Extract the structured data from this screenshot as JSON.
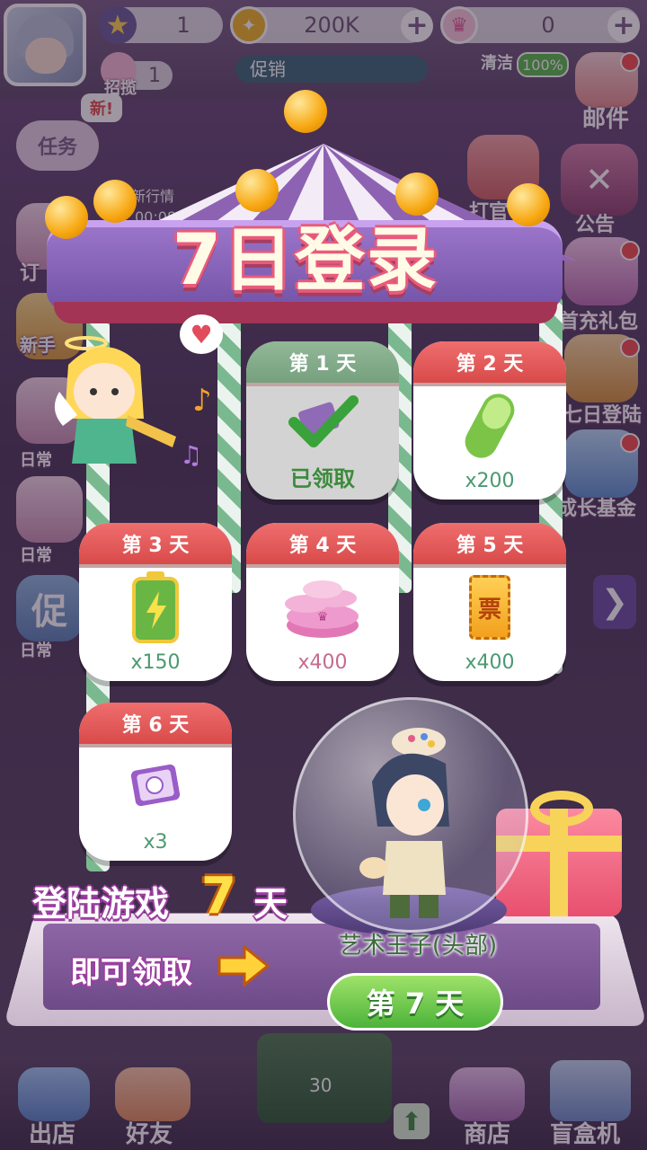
{
  "topbar": {
    "level": "1",
    "coins": "200K",
    "gems": "0",
    "promo_label": "促销",
    "clean_label": "清洁",
    "clean_value": "100%",
    "recruit_count": "1",
    "recruit_label": "招揽"
  },
  "left_menu": {
    "new_badge": "新!",
    "task": "任务",
    "news": "新行情",
    "timer": "00:08",
    "order": "订",
    "newbie": "新手",
    "daily1": "日常",
    "daily2": "日常",
    "promo_big": "促",
    "daily3": "日常"
  },
  "right_menu": {
    "mail": "邮件",
    "play": "打官",
    "notice": "公告",
    "first_charge": "首充礼包",
    "seven_day": "七日登陆",
    "growth_fund": "成长基金"
  },
  "dialog": {
    "title": "7日登录",
    "days": [
      {
        "label": "第 1 天",
        "status": "已领取"
      },
      {
        "label": "第 2 天",
        "qty": "x200",
        "icon": "green-capsule-icon"
      },
      {
        "label": "第 3 天",
        "qty": "x150",
        "icon": "battery-icon"
      },
      {
        "label": "第 4 天",
        "qty": "x400",
        "icon": "pink-coins-icon"
      },
      {
        "label": "第 5 天",
        "qty": "x400",
        "icon": "ticket-icon",
        "ticket_text": "票"
      },
      {
        "label": "第 6 天",
        "qty": "x3",
        "icon": "cat-card-icon"
      }
    ],
    "promo_line1": "登陆游戏",
    "promo_num": "7",
    "promo_unit": "天",
    "promo_line2": "即可领取",
    "prize_name": "艺术王子(头部)",
    "day7_button": "第 7 天"
  },
  "bottombar": {
    "shop_out": "出店",
    "friends": "好友",
    "center_sign": "30",
    "store": "商店",
    "blindbox": "盲盒机"
  },
  "colors": {
    "header_red": "#e15252",
    "claimed_green": "#3d8a3d",
    "qty_green": "#4a9a70",
    "qty_pink": "#c66a8f",
    "button_green": "#4db33a"
  }
}
